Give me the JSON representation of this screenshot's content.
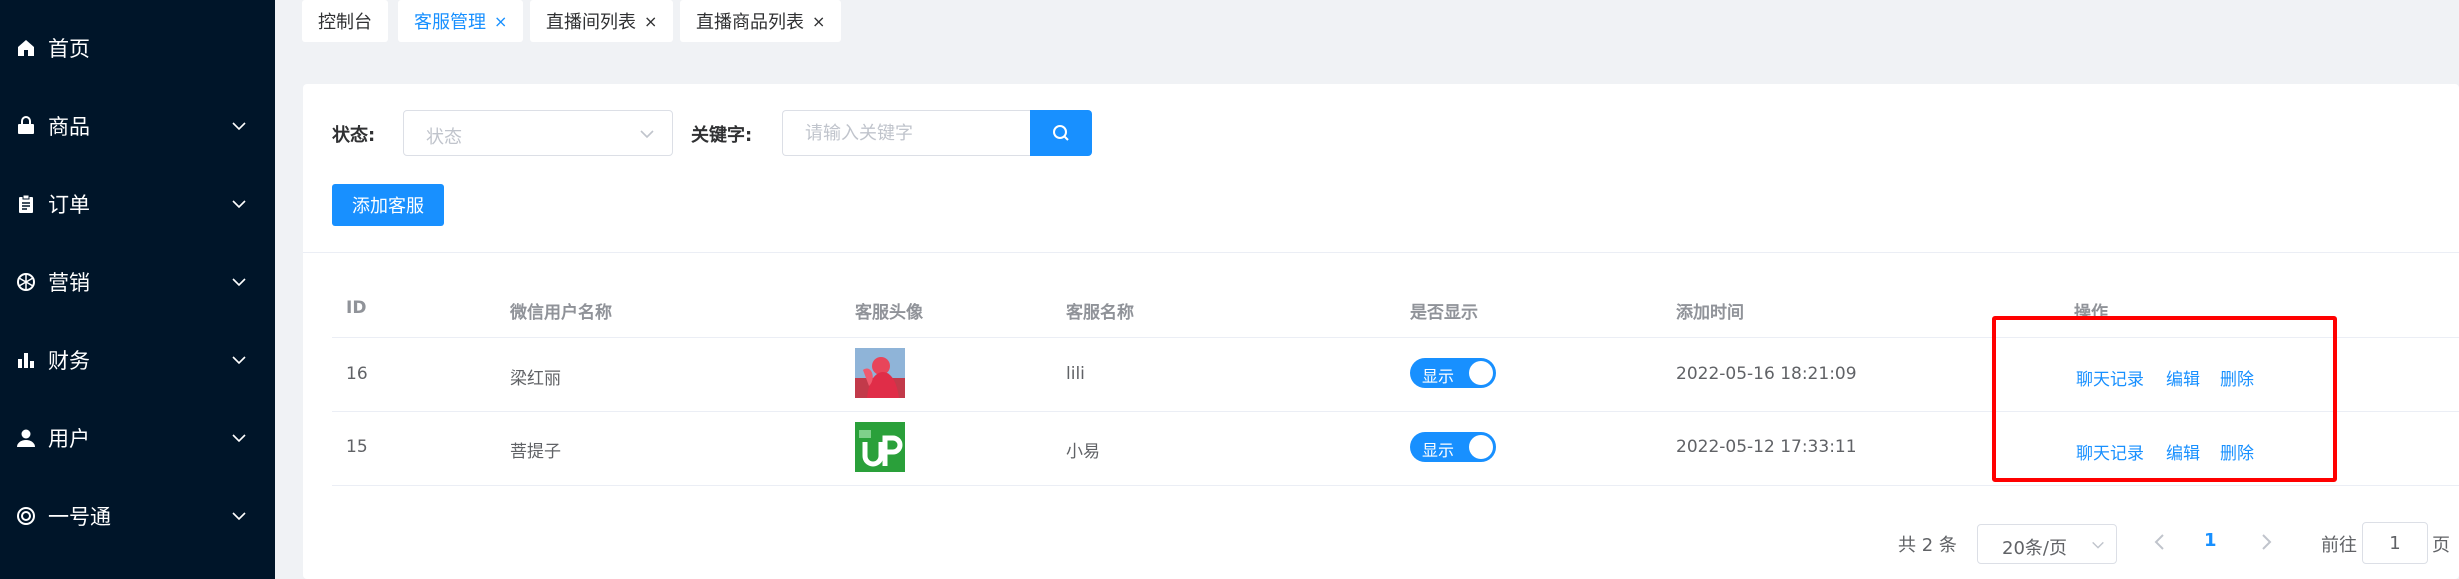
{
  "sidebar": {
    "items": [
      {
        "label": "首页",
        "icon": "home-icon",
        "has_children": false
      },
      {
        "label": "商品",
        "icon": "shopping-bag-icon",
        "has_children": true
      },
      {
        "label": "订单",
        "icon": "clipboard-icon",
        "has_children": true
      },
      {
        "label": "营销",
        "icon": "aperture-icon",
        "has_children": true
      },
      {
        "label": "财务",
        "icon": "bar-chart-icon",
        "has_children": true
      },
      {
        "label": "用户",
        "icon": "user-icon",
        "has_children": true
      },
      {
        "label": "一号通",
        "icon": "lifebuoy-icon",
        "has_children": true
      }
    ]
  },
  "tabs": [
    {
      "label": "控制台",
      "closable": false,
      "active": false
    },
    {
      "label": "客服管理",
      "closable": true,
      "active": true
    },
    {
      "label": "直播间列表",
      "closable": true,
      "active": false
    },
    {
      "label": "直播商品列表",
      "closable": true,
      "active": false
    }
  ],
  "tab_close_symbol": "×",
  "filter": {
    "status_label": "状态:",
    "status_placeholder": "状态",
    "keyword_label": "关键字:",
    "keyword_placeholder": "请输入关键字"
  },
  "add_button_label": "添加客服",
  "table": {
    "headers": [
      "ID",
      "微信用户名称",
      "客服头像",
      "客服名称",
      "是否显示",
      "添加时间",
      "操作"
    ],
    "rows": [
      {
        "id": "16",
        "wechat_name": "梁红丽",
        "avatar": "red-figure-avatar",
        "name": "lili",
        "show": "显示",
        "added": "2022-05-16 18:21:09"
      },
      {
        "id": "15",
        "wechat_name": "菩提子",
        "avatar": "green-up-logo-avatar",
        "name": "小易",
        "show": "显示",
        "added": "2022-05-12 17:33:11"
      }
    ],
    "actions": {
      "chat": "聊天记录",
      "edit": "编辑",
      "delete": "删除"
    }
  },
  "pagination": {
    "total": "共 2 条",
    "page_size": "20条/页",
    "current_page": "1",
    "goto_label": "前往",
    "goto_value": "1",
    "page_suffix": "页"
  },
  "colors": {
    "primary": "#1890ff",
    "sidebar_bg": "#001529",
    "highlight": "#ff0000"
  }
}
